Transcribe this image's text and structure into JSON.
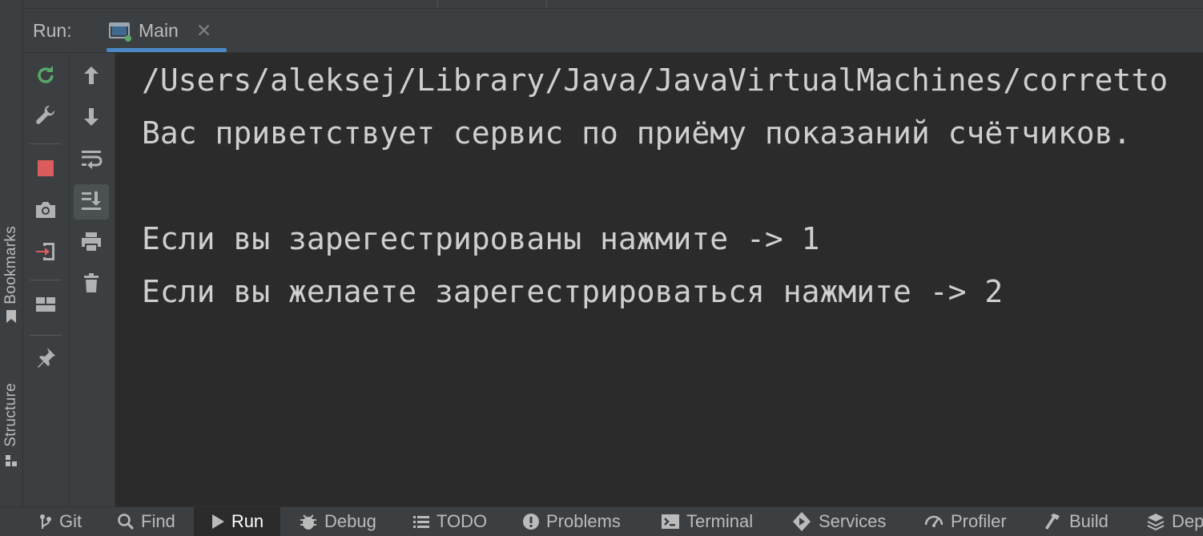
{
  "left_stripe": {
    "bookmarks_label": "Bookmarks",
    "structure_label": "Structure"
  },
  "run_panel": {
    "title": "Run:",
    "tabs": [
      {
        "label": "Main",
        "icon": "run-config-icon"
      }
    ]
  },
  "toolbar_primary": [
    "rerun-icon",
    "wrench-icon",
    "stop-icon",
    "camera-icon",
    "exit-icon",
    "layout-icon",
    "pin-icon"
  ],
  "toolbar_secondary": [
    "arrow-up-icon",
    "arrow-down-icon",
    "soft-wrap-icon",
    "scroll-to-end-icon",
    "print-icon",
    "trash-icon"
  ],
  "console": {
    "lines": [
      "/Users/aleksej/Library/Java/JavaVirtualMachines/corretto",
      "Вас приветствует сервис по приёму показаний счётчиков.",
      "",
      "Если вы зарегестрированы нажмите -> 1",
      "Если вы желаете зарегестрироваться нажмите -> 2"
    ]
  },
  "bottom_bar": {
    "items": [
      {
        "label": "Git",
        "icon": "git-icon"
      },
      {
        "label": "Find",
        "icon": "search-icon"
      },
      {
        "label": "Run",
        "icon": "play-icon",
        "active": true
      },
      {
        "label": "Debug",
        "icon": "bug-icon"
      },
      {
        "label": "TODO",
        "icon": "list-icon"
      },
      {
        "label": "Problems",
        "icon": "warning-icon"
      },
      {
        "label": "Terminal",
        "icon": "terminal-icon"
      },
      {
        "label": "Services",
        "icon": "services-icon"
      },
      {
        "label": "Profiler",
        "icon": "profiler-icon"
      },
      {
        "label": "Build",
        "icon": "hammer-icon"
      },
      {
        "label": "Dep",
        "icon": "dependencies-icon"
      }
    ]
  },
  "colors": {
    "accent": "#4a88c7",
    "stop": "#db5c5c",
    "rerun": "#59a869",
    "console_text": "#cfcfcf"
  }
}
